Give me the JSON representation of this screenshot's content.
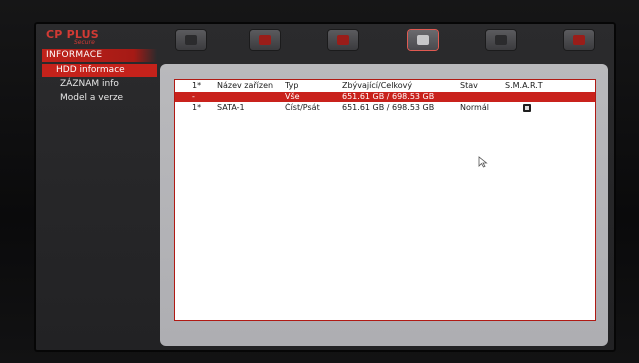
{
  "brand": {
    "name": "CP PLUS",
    "tagline": "Secure"
  },
  "section_title": "INFORMACE",
  "toolbar": {
    "icons": [
      "camera-icon",
      "record-icon",
      "alarm-icon",
      "info-icon",
      "network-icon",
      "settings-icon"
    ],
    "active_index": 3
  },
  "sidebar": {
    "items": [
      {
        "label": "HDD informace",
        "active": true
      },
      {
        "label": "ZÁZNAM info",
        "active": false
      },
      {
        "label": "Model a verze",
        "active": false
      }
    ]
  },
  "table": {
    "headers": {
      "no": "1*",
      "name": "Název zařízen",
      "type": "Typ",
      "capacity": "Zbývající/Celkový",
      "state": "Stav",
      "smart": "S.M.A.R.T"
    },
    "rows": [
      {
        "no": "-",
        "name": "",
        "type": "Vše",
        "capacity": "651.61 GB / 698.53 GB",
        "state": "",
        "smart": "",
        "selected": true
      },
      {
        "no": "1*",
        "name": "SATA-1",
        "type": "Číst/Psát",
        "capacity": "651.61 GB / 698.53 GB",
        "state": "Normál",
        "smart": "smart-status-icon",
        "selected": false
      }
    ]
  },
  "colors": {
    "accent": "#c5221b",
    "panel": "#b4b4b8",
    "screen": "#262628"
  }
}
